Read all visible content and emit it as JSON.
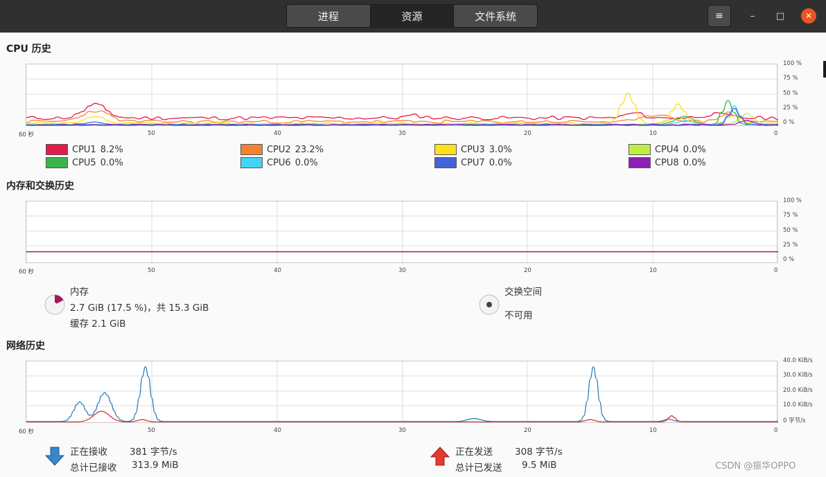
{
  "tabs": [
    {
      "label": "进程",
      "active": false
    },
    {
      "label": "资源",
      "active": true
    },
    {
      "label": "文件系统",
      "active": false
    }
  ],
  "window": {
    "menu_icon": "≡",
    "minimize_icon": "–",
    "maximize_icon": "□",
    "close_icon": "✕"
  },
  "cpu": {
    "title": "CPU 历史",
    "y_ticks": [
      "100 %",
      "75 %",
      "50 %",
      "25 %",
      "0 %"
    ],
    "x_ticks": [
      "60 秒",
      "50",
      "40",
      "30",
      "20",
      "10",
      "0"
    ],
    "legend": [
      {
        "name": "CPU1",
        "value": "8.2%",
        "color": "#e6194b"
      },
      {
        "name": "CPU2",
        "value": "23.2%",
        "color": "#f58231"
      },
      {
        "name": "CPU3",
        "value": "3.0%",
        "color": "#ffe119"
      },
      {
        "name": "CPU4",
        "value": "0.0%",
        "color": "#bfef45"
      },
      {
        "name": "CPU5",
        "value": "0.0%",
        "color": "#3cb44b"
      },
      {
        "name": "CPU6",
        "value": "0.0%",
        "color": "#42d4f4"
      },
      {
        "name": "CPU7",
        "value": "0.0%",
        "color": "#4363d8"
      },
      {
        "name": "CPU8",
        "value": "0.0%",
        "color": "#911eb4"
      }
    ]
  },
  "memory": {
    "title": "内存和交换历史",
    "y_ticks": [
      "100 %",
      "75 %",
      "50 %",
      "25 %",
      "0 %"
    ],
    "x_ticks": [
      "60 秒",
      "50",
      "40",
      "30",
      "20",
      "10",
      "0"
    ],
    "mem_label": "内存",
    "mem_usage": "2.7 GiB (17.5 %)，共 15.3 GiB",
    "mem_cache": "缓存 2.1 GiB",
    "swap_label": "交换空间",
    "swap_status": "不可用",
    "mem_color": "#a3185c",
    "mem_percent": 17.5
  },
  "network": {
    "title": "网络历史",
    "y_ticks": [
      "40.0 KiB/s",
      "30.0 KiB/s",
      "20.0 KiB/s",
      "10.0 KiB/s",
      "0 字节/s"
    ],
    "x_ticks": [
      "60 秒",
      "50",
      "40",
      "30",
      "20",
      "10",
      "0"
    ],
    "recv_label": "正在接收",
    "recv_rate": "381 字节/s",
    "recv_total_label": "总计已接收",
    "recv_total": "313.9 MiB",
    "send_label": "正在发送",
    "send_rate": "308 字节/s",
    "send_total_label": "总计已发送",
    "send_total": "9.5 MiB",
    "recv_color": "#1f77b4",
    "send_color": "#d62728"
  },
  "watermark": "CSDN @振华OPPO"
}
